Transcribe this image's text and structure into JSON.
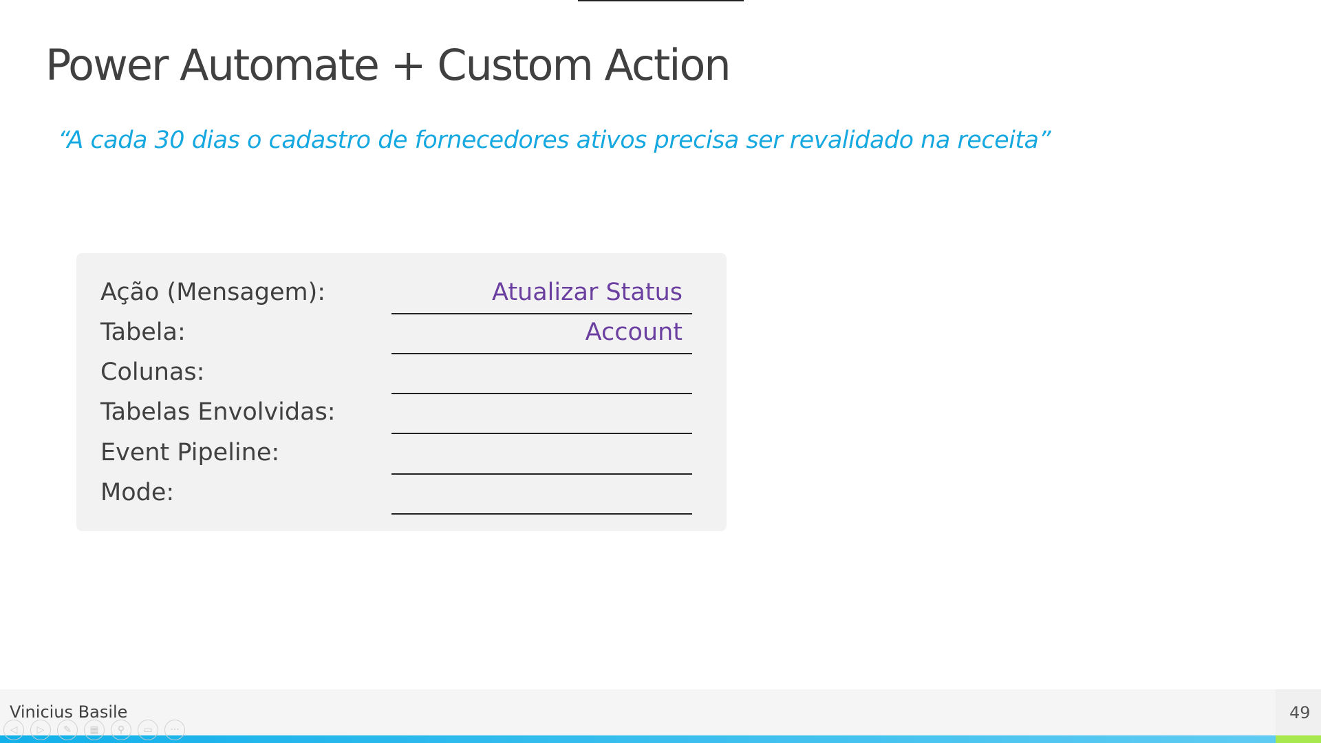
{
  "slide": {
    "title": "Power Automate + Custom Action",
    "quote": "“A cada 30 dias o cadastro de fornecedores ativos precisa ser revalidado na receita”",
    "form": [
      {
        "label": "Ação (Mensagem):",
        "value": "Atualizar Status"
      },
      {
        "label": "Tabela:",
        "value": "Account"
      },
      {
        "label": "Colunas:",
        "value": ""
      },
      {
        "label": "Tabelas Envolvidas:",
        "value": ""
      },
      {
        "label": "Event Pipeline:",
        "value": ""
      },
      {
        "label": "Mode:",
        "value": ""
      }
    ]
  },
  "footer": {
    "author": "Vinicius Basile",
    "page_number": "49"
  },
  "controls": [
    "previous-icon",
    "next-icon",
    "pen-icon",
    "slides-grid-icon",
    "zoom-icon",
    "subtitles-icon",
    "more-icon"
  ],
  "colors": {
    "accent": "#16a8e0",
    "value": "#6a3fa0",
    "bar_end": "#a6e84e"
  }
}
